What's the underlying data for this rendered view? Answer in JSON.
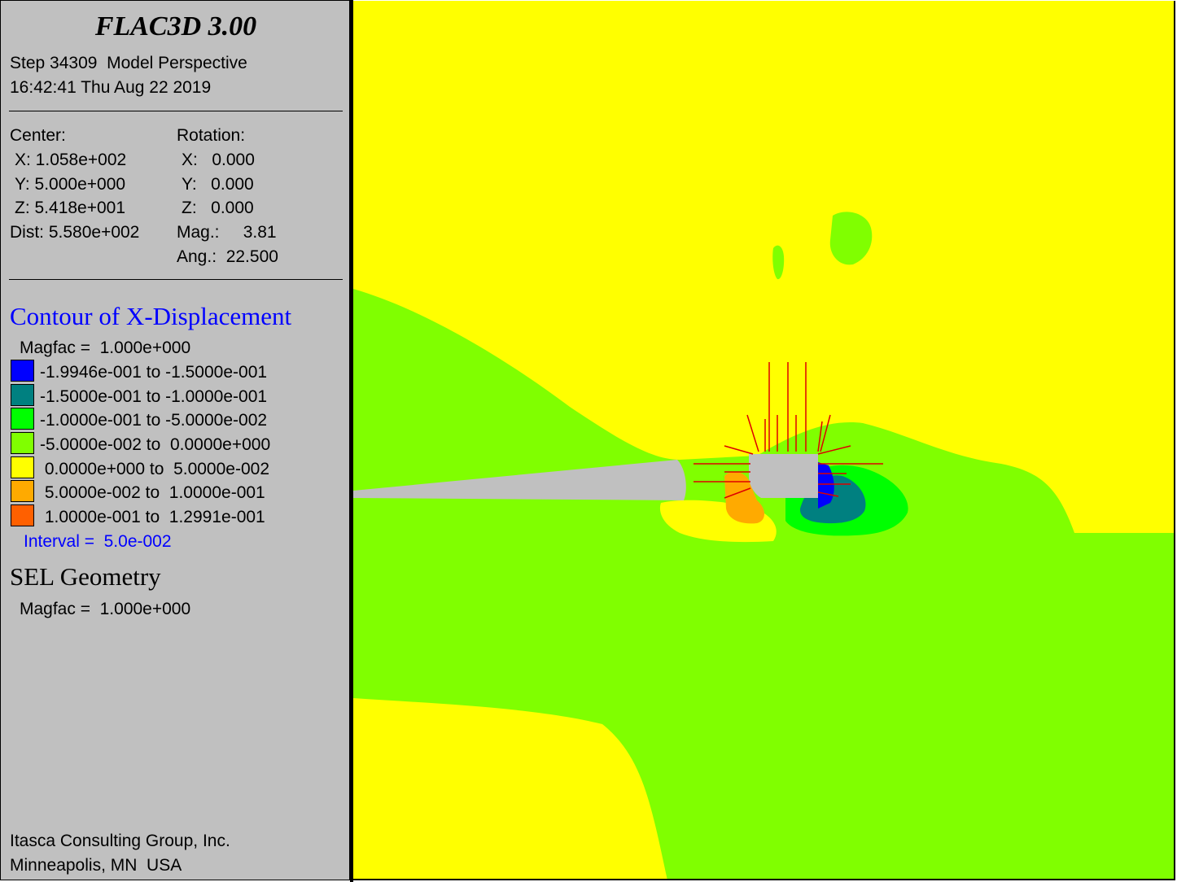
{
  "panel": {
    "title": "FLAC3D 3.00",
    "step_line": "Step 34309  Model Perspective",
    "timestamp": "16:42:41 Thu Aug 22 2019",
    "center": {
      "label": "Center:",
      "x": "X: 1.058e+002",
      "y": "Y: 5.000e+000",
      "z": "Z: 5.418e+001",
      "dist": "Dist: 5.580e+002"
    },
    "rotation": {
      "label": "Rotation:",
      "x": "X:   0.000",
      "y": "Y:   0.000",
      "z": "Z:   0.000",
      "mag": "Mag.:     3.81",
      "ang": "Ang.:  22.500"
    },
    "contour": {
      "heading": "Contour of X-Displacement",
      "magfac": "Magfac =  1.000e+000",
      "legend": [
        {
          "label": "-1.9946e-001 to -1.5000e-001",
          "color": "#0000ff"
        },
        {
          "label": "-1.5000e-001 to -1.0000e-001",
          "color": "#008080"
        },
        {
          "label": "-1.0000e-001 to -5.0000e-002",
          "color": "#00ff00"
        },
        {
          "label": "-5.0000e-002 to  0.0000e+000",
          "color": "#80ff00"
        },
        {
          "label": " 0.0000e+000 to  5.0000e-002",
          "color": "#ffff00"
        },
        {
          "label": " 5.0000e-002 to  1.0000e-001",
          "color": "#ffaa00"
        },
        {
          "label": " 1.0000e-001 to  1.2991e-001",
          "color": "#ff6000"
        }
      ],
      "interval": "Interval =  5.0e-002"
    },
    "sel": {
      "heading": "SEL Geometry",
      "magfac": "Magfac =  1.000e+000"
    },
    "footer": {
      "company": "Itasca Consulting Group, Inc.",
      "location": "Minneapolis, MN  USA"
    }
  },
  "colors": {
    "panel_bg": "#c0c0c0",
    "tunnel_gray": "#c0c0c0",
    "cable_red": "#dd0000"
  }
}
